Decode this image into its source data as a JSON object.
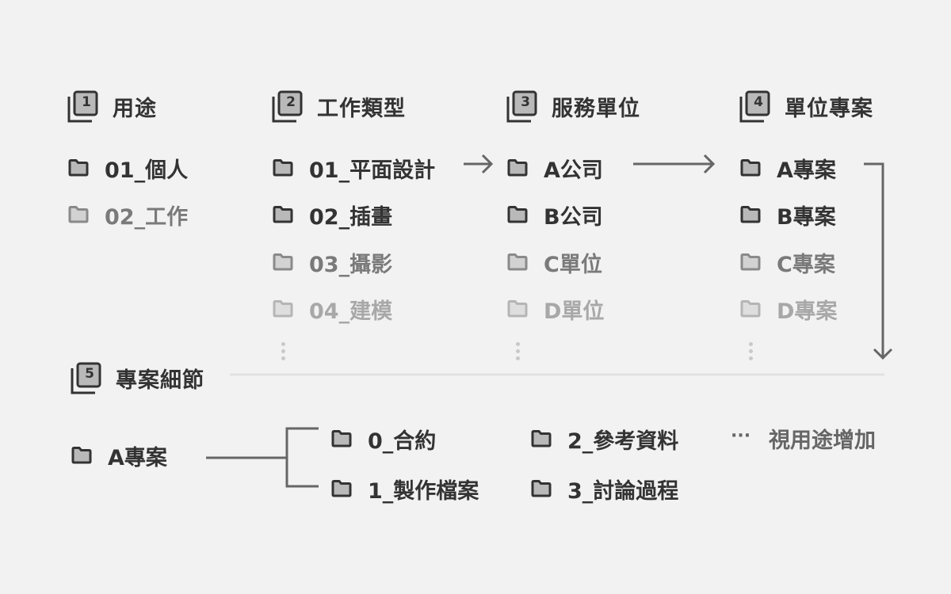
{
  "colors": {
    "background": "#f2f2f2",
    "text_primary": "#333333",
    "text_secondary": "#7a7a7a",
    "text_tertiary": "#a8a8a8",
    "folder_fill": "#b9b9b9",
    "connector": "#666666",
    "divider": "#e2e2e2"
  },
  "columns": [
    {
      "step": "1",
      "title": "用途",
      "items": [
        {
          "label": "01_個人",
          "level": "primary"
        },
        {
          "label": "02_工作",
          "level": "secondary"
        }
      ],
      "has_more": false
    },
    {
      "step": "2",
      "title": "工作類型",
      "items": [
        {
          "label": "01_平面設計",
          "level": "primary"
        },
        {
          "label": "02_插畫",
          "level": "primary"
        },
        {
          "label": "03_攝影",
          "level": "secondary"
        },
        {
          "label": "04_建模",
          "level": "tertiary"
        }
      ],
      "has_more": true
    },
    {
      "step": "3",
      "title": "服務單位",
      "items": [
        {
          "label": "A公司",
          "level": "primary"
        },
        {
          "label": "B公司",
          "level": "primary"
        },
        {
          "label": "C單位",
          "level": "secondary"
        },
        {
          "label": "D單位",
          "level": "tertiary"
        }
      ],
      "has_more": true
    },
    {
      "step": "4",
      "title": "單位專案",
      "items": [
        {
          "label": "A專案",
          "level": "primary"
        },
        {
          "label": "B專案",
          "level": "primary"
        },
        {
          "label": "C專案",
          "level": "secondary"
        },
        {
          "label": "D專案",
          "level": "tertiary"
        }
      ],
      "has_more": true
    }
  ],
  "details": {
    "step": "5",
    "title": "專案細節",
    "root": "A專案",
    "children": [
      {
        "label": "0_合約"
      },
      {
        "label": "1_製作檔案"
      },
      {
        "label": "2_參考資料"
      },
      {
        "label": "3_討論過程"
      }
    ],
    "ellipsis": "···",
    "note": "視用途增加"
  }
}
